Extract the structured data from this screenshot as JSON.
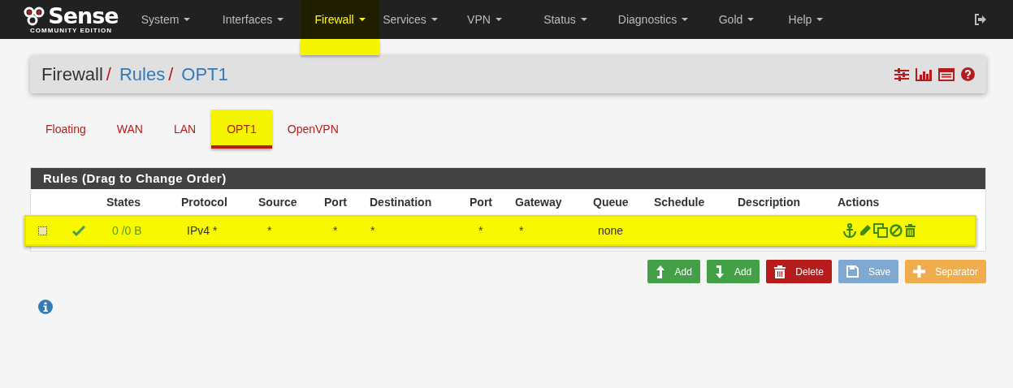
{
  "logo": {
    "word": "Sense",
    "subtitle": "COMMUNITY EDITION"
  },
  "nav": [
    {
      "label": "System",
      "selected": false
    },
    {
      "label": "Interfaces",
      "selected": false
    },
    {
      "label": "Firewall",
      "selected": true
    },
    {
      "label": "Services",
      "selected": false
    },
    {
      "label": "VPN",
      "selected": false
    },
    {
      "label": "Status",
      "selected": false
    },
    {
      "label": "Diagnostics",
      "selected": false
    },
    {
      "label": "Gold",
      "selected": false
    },
    {
      "label": "Help",
      "selected": false
    }
  ],
  "breadcrumb": [
    {
      "label": "Firewall",
      "link": false,
      "separator": "/"
    },
    {
      "label": "Rules",
      "link": true,
      "separator": "/"
    },
    {
      "label": "OPT1",
      "link": true
    }
  ],
  "tabs": [
    {
      "label": "Floating",
      "selected": false
    },
    {
      "label": "WAN",
      "selected": false
    },
    {
      "label": "LAN",
      "selected": false
    },
    {
      "label": "OPT1",
      "selected": true
    },
    {
      "label": "OpenVPN",
      "selected": false
    }
  ],
  "table": {
    "title": "Rules (Drag to Change Order)",
    "columns": [
      "States",
      "Protocol",
      "Source",
      "Port",
      "Destination",
      "Port",
      "Gateway",
      "Queue",
      "Schedule",
      "Description",
      "Actions"
    ],
    "rows": [
      {
        "selected": true,
        "enabled": true,
        "states": "0 /0 B",
        "protocol": "IPv4 *",
        "source": "*",
        "source_port": "*",
        "destination": "*",
        "destination_port": "*",
        "gateway": "*",
        "queue": "none"
      }
    ]
  },
  "buttons": [
    {
      "kind": "add-top",
      "label": "Add"
    },
    {
      "kind": "add-bottom",
      "label": "Add"
    },
    {
      "kind": "delete",
      "label": "Delete"
    },
    {
      "kind": "save",
      "label": "Save"
    },
    {
      "kind": "separator",
      "label": "Separator"
    }
  ]
}
